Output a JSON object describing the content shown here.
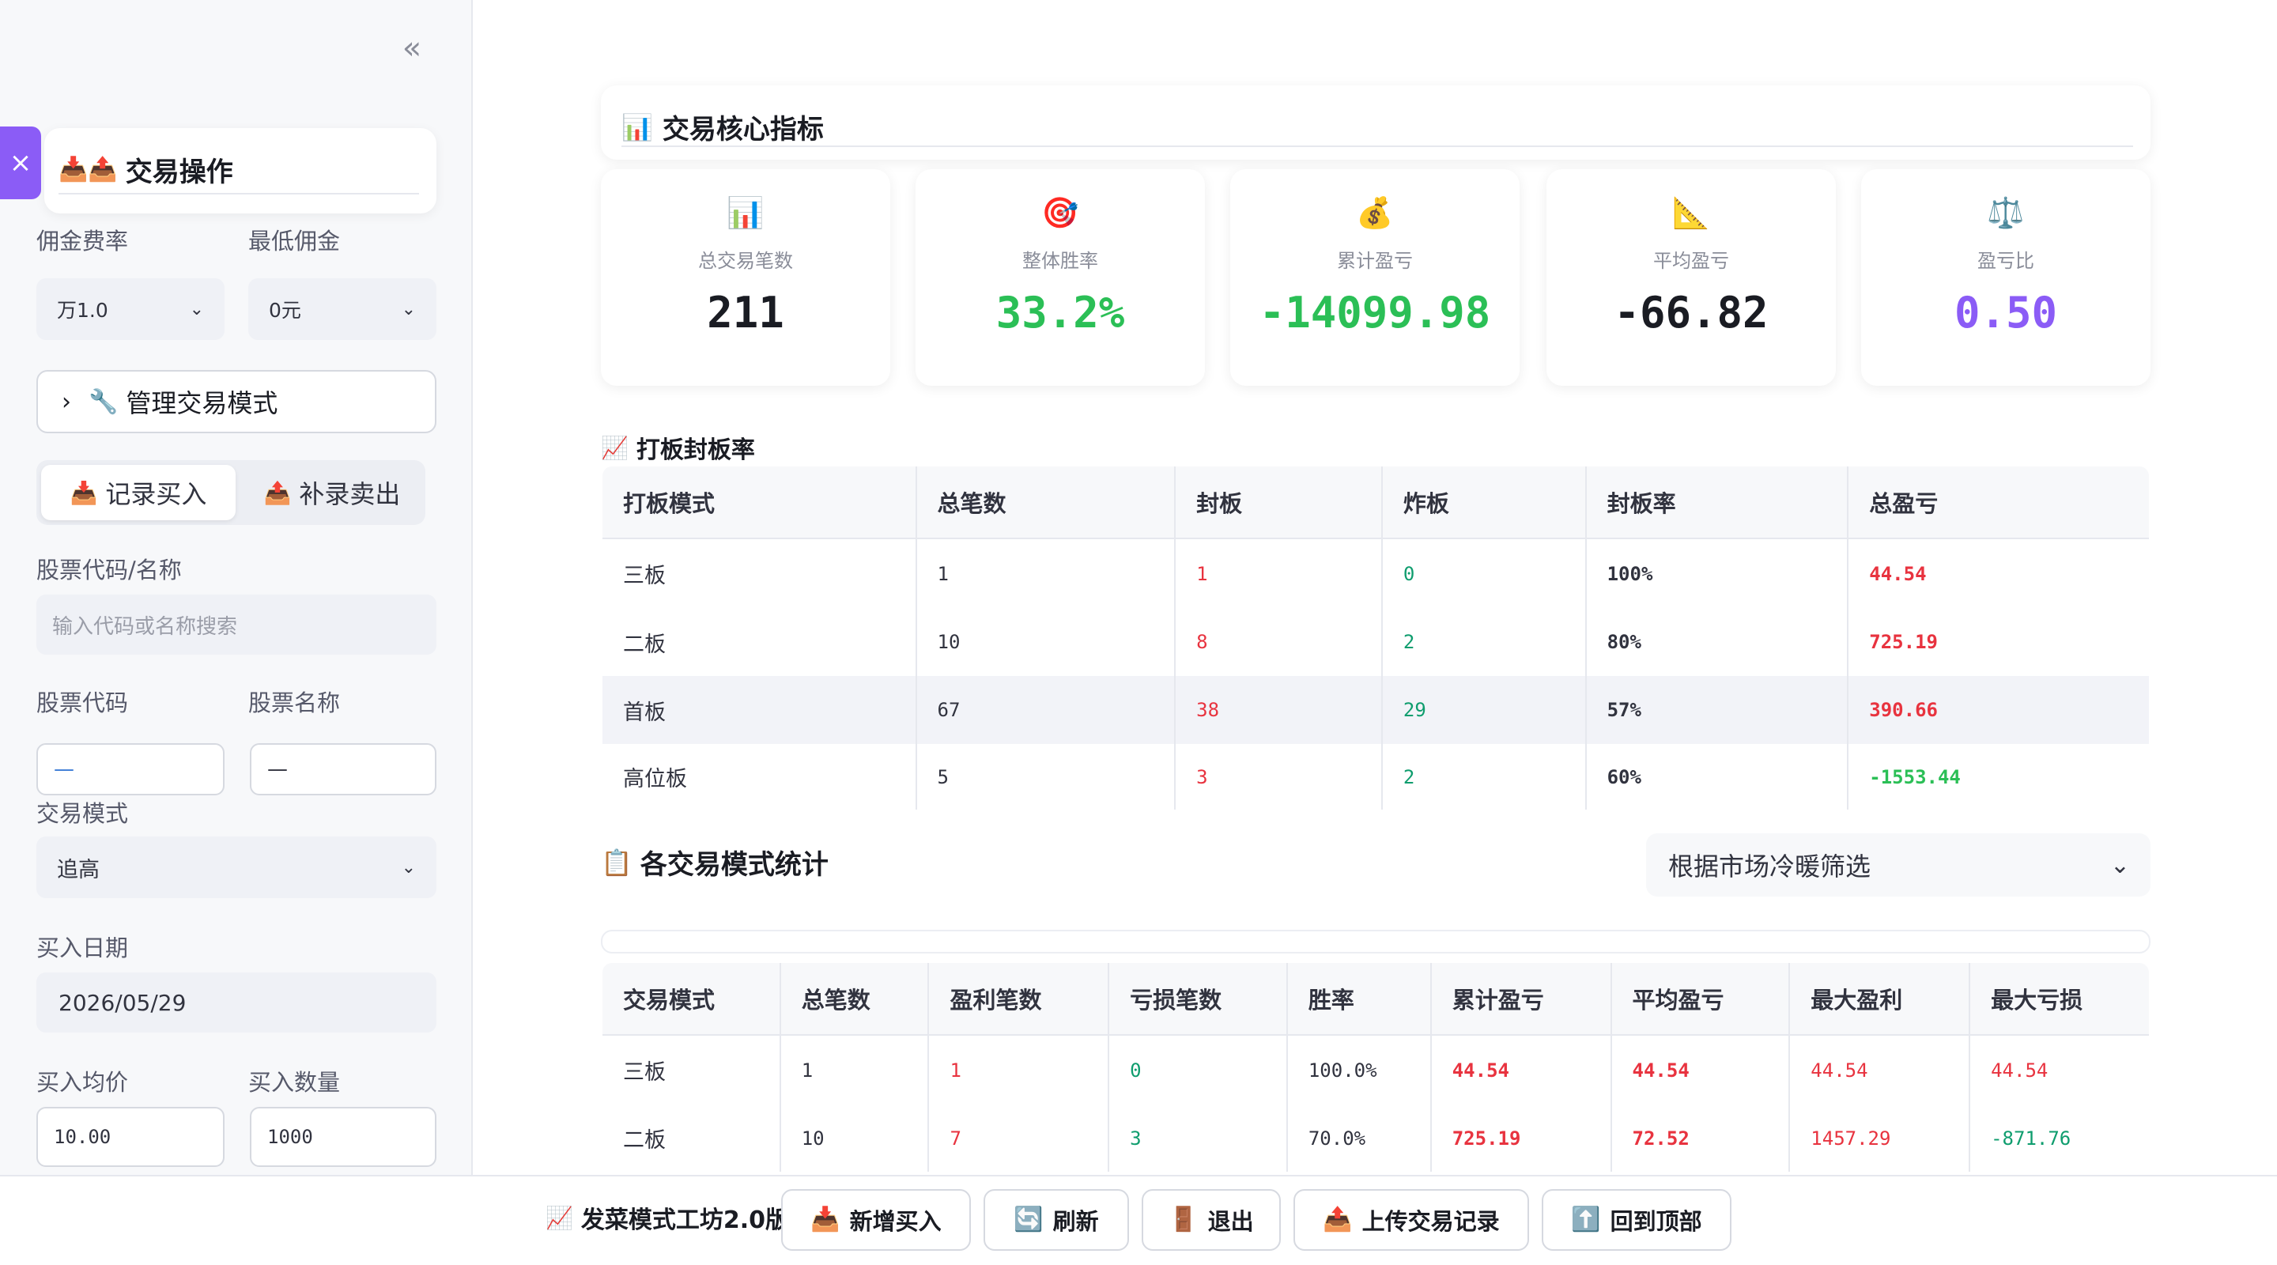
{
  "sidebar": {
    "collapse_icon": "«",
    "close_icon": "×",
    "section_title": "交易操作",
    "section_icons": "📥📤",
    "commission_label": "佣金费率",
    "commission_value": "万1.0",
    "min_commission_label": "最低佣金",
    "min_commission_value": "0元",
    "manage_modes_label": "管理交易模式",
    "tabs": {
      "buy_label": "记录买入",
      "sell_label": "补录卖出"
    },
    "stock_search_label": "股票代码/名称",
    "stock_search_placeholder": "输入代码或名称搜索",
    "stock_code_label": "股票代码",
    "stock_code_value": "—",
    "stock_name_label": "股票名称",
    "stock_name_value": "—",
    "trade_mode_label": "交易模式",
    "trade_mode_value": "追高",
    "buy_date_label": "买入日期",
    "buy_date_value": "2026/05/29",
    "buy_price_label": "买入均价",
    "buy_price_value": "10.00",
    "buy_qty_label": "买入数量",
    "buy_qty_value": "1000"
  },
  "core": {
    "title": "交易核心指标",
    "metrics": [
      {
        "icon": "📊",
        "label": "总交易笔数",
        "value": "211",
        "color": "#1a1c23"
      },
      {
        "icon": "🎯",
        "label": "整体胜率",
        "value": "33.2%",
        "color": "#2bbf56"
      },
      {
        "icon": "💰",
        "label": "累计盈亏",
        "value": "-14099.98",
        "color": "#2bbf56"
      },
      {
        "icon": "📐",
        "label": "平均盈亏",
        "value": "-66.82",
        "color": "#1a1c23"
      },
      {
        "icon": "⚖️",
        "label": "盈亏比",
        "value": "0.50",
        "color": "#8b5cf6"
      }
    ]
  },
  "board": {
    "title": "打板封板率",
    "headers": [
      "打板模式",
      "总笔数",
      "封板",
      "炸板",
      "封板率",
      "总盈亏"
    ],
    "rows": [
      [
        "三板",
        "1",
        "1",
        "0",
        "100%",
        "44.54"
      ],
      [
        "二板",
        "10",
        "8",
        "2",
        "80%",
        "725.19"
      ],
      [
        "首板",
        "67",
        "38",
        "29",
        "57%",
        "390.66"
      ],
      [
        "高位板",
        "5",
        "3",
        "2",
        "60%",
        "-1553.44"
      ]
    ]
  },
  "modes": {
    "title": "各交易模式统计",
    "filter_label": "根据市场冷暖筛选",
    "headers": [
      "交易模式",
      "总笔数",
      "盈利笔数",
      "亏损笔数",
      "胜率",
      "累计盈亏",
      "平均盈亏",
      "最大盈利",
      "最大亏损"
    ],
    "rows": [
      [
        "三板",
        "1",
        "1",
        "0",
        "100.0%",
        "44.54",
        "44.54",
        "44.54",
        "44.54"
      ],
      [
        "二板",
        "10",
        "7",
        "3",
        "70.0%",
        "725.19",
        "72.52",
        "1457.29",
        "-871.76"
      ]
    ]
  },
  "bottom": {
    "brand": "发菜模式工坊2.0版",
    "buttons": {
      "add_buy": "新增买入",
      "refresh": "刷新",
      "logout": "退出",
      "upload": "上传交易记录",
      "top": "回到顶部"
    }
  }
}
